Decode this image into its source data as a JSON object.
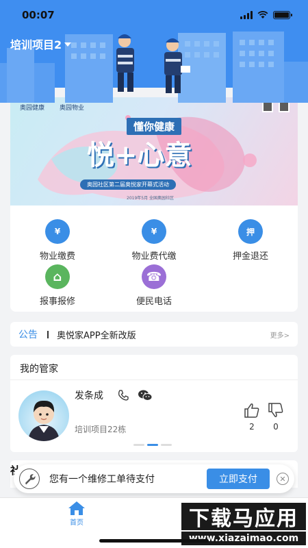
{
  "status_bar": {
    "time": "00:07"
  },
  "header": {
    "project_name": "培训项目2"
  },
  "banner": {
    "logo_left": "奥园健康",
    "logo_right": "奥园物业",
    "headline": "懂你健康",
    "slogan": "悦+心意",
    "subtitle": "奥园社区第二届奥悦家开幕式活动",
    "date_line": "2019年5月 全国奥园社区"
  },
  "services": [
    {
      "label": "物业缴费",
      "icon": "yen-icon",
      "color": "#3a8ee6",
      "glyph": "¥"
    },
    {
      "label": "物业费代缴",
      "icon": "yen-icon",
      "color": "#3a8ee6",
      "glyph": "¥"
    },
    {
      "label": "押金退还",
      "icon": "deposit-icon",
      "color": "#3a8ee6",
      "glyph": "押"
    },
    {
      "label": "报事报修",
      "icon": "house-repair-icon",
      "color": "#5ab55e",
      "glyph": "⌂"
    },
    {
      "label": "便民电话",
      "icon": "telephone-icon",
      "color": "#9b6fd6",
      "glyph": "☎"
    }
  ],
  "notice": {
    "tag": "公告",
    "text": "奥悦家APP全新改版",
    "more": "更多>"
  },
  "steward": {
    "section_title": "我的管家",
    "name": "发条成",
    "area": "培训项目22栋",
    "likes": "2",
    "dislikes": "0"
  },
  "next_section": {
    "peek_char": "社"
  },
  "pay_bar": {
    "text": "您有一个维修工单待支付",
    "button": "立即支付"
  },
  "tabbar": {
    "home_label": "首页"
  },
  "watermark": {
    "top": "下载马应用",
    "bottom": "www.xiazaimao.com"
  },
  "colors": {
    "primary": "#3a8ee6",
    "header_bg": "#3f8ef0"
  }
}
